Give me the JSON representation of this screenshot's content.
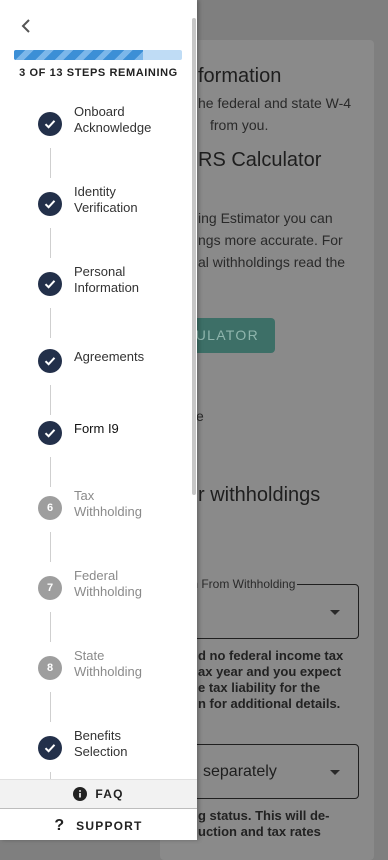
{
  "drawer": {
    "progress_fraction": 0.77,
    "steps_remaining": "3 OF 13 STEPS REMAINING",
    "steps": [
      {
        "lines": [
          "Onboard",
          "Acknowledge"
        ],
        "status": "done",
        "icon": "check-icon"
      },
      {
        "lines": [
          "Identity",
          "Verification"
        ],
        "status": "done",
        "icon": "check-icon"
      },
      {
        "lines": [
          "Personal",
          "Information"
        ],
        "status": "done",
        "icon": "check-icon"
      },
      {
        "lines": [
          "Agreements"
        ],
        "status": "done",
        "icon": "check-icon"
      },
      {
        "lines": [
          "Form I9"
        ],
        "status": "current",
        "icon": "check-icon"
      },
      {
        "number": "6",
        "lines": [
          "Tax",
          "Withholding"
        ],
        "status": "todo"
      },
      {
        "number": "7",
        "lines": [
          "Federal",
          "Withholding"
        ],
        "status": "todo"
      },
      {
        "number": "8",
        "lines": [
          "State",
          "Withholding"
        ],
        "status": "todo"
      },
      {
        "lines": [
          "Benefits",
          "Selection"
        ],
        "status": "done",
        "icon": "check-icon"
      }
    ],
    "faq_label": "FAQ",
    "support_label": "SUPPORT"
  },
  "background": {
    "title_fragment": "formation",
    "intro_line1": "he federal and state W-4",
    "intro_line2": "from you.",
    "calc_heading": "RS Calculator",
    "estimator_line1": "ing Estimator you can",
    "estimator_line2": "ngs more accurate. For",
    "estimator_line3": "al withholdings read the",
    "calculator_button": "ULATOR",
    "fragment_e": "e",
    "withholdings_heading": "r withholdings",
    "exemption_label": "ion From Withholding",
    "exempt_line1": "d no federal income tax",
    "exempt_line2": "ax year and you expect",
    "exempt_line3": "e tax liability for the",
    "exempt_line4": "n for additional details.",
    "filing_select_value": "separately",
    "filing_line1": "g status. This will de-",
    "filing_line2": "uction and tax rates"
  },
  "colors": {
    "check_circle": "#23304a",
    "todo_circle": "#9e9e9e",
    "progress": "#3c8fd6",
    "button_bg": "#3d6f67"
  }
}
